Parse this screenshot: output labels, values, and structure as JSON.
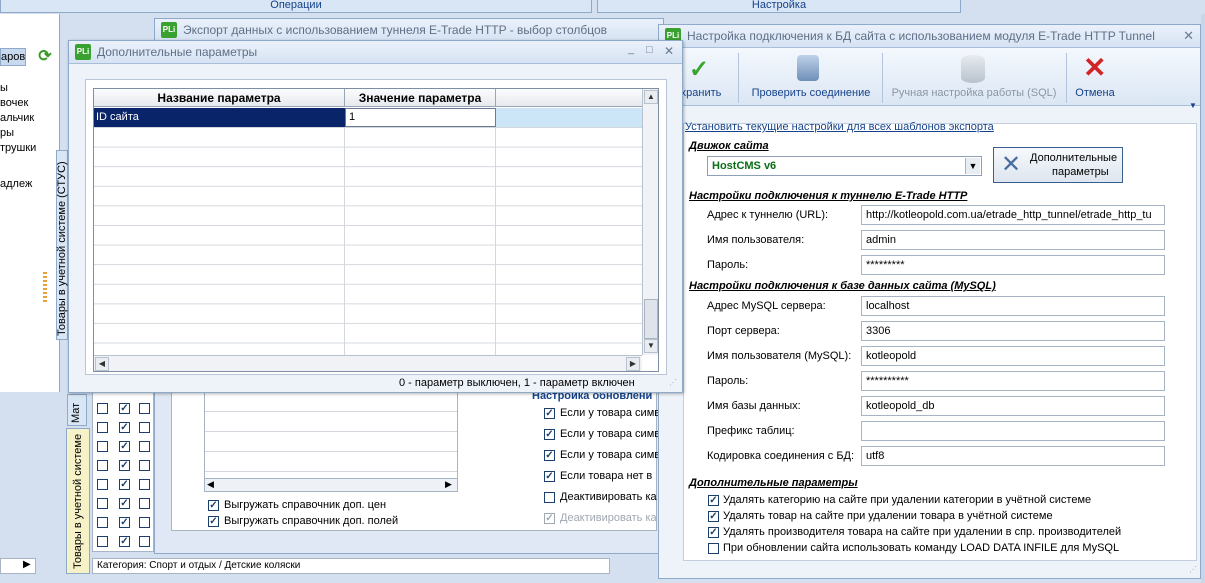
{
  "ribbon": {
    "operations_label": "Операции",
    "settings_label": "Настройка"
  },
  "left_panel": {
    "top_button_label": "аров",
    "items": [
      "ы",
      "вочек",
      "альчик",
      "ры",
      "трушки"
    ],
    "item_extra": "адлеж",
    "vertical_label_1": "Товары в учетной системе (СТУС)"
  },
  "bottom_panel": {
    "tab_materials": "Мат",
    "tab_goods": "Товары в учетной системе",
    "category_path": "Категория: Спорт и отдых / Детские коляски",
    "checkbox_rows": 8
  },
  "export_window": {
    "title": "Экспорт данных с использованием туннеля E-Trade HTTP - выбор столбцов",
    "checks_left": [
      {
        "label": "Выгружать справочник доп. цен",
        "checked": true
      },
      {
        "label": "Выгружать справочник доп. полей",
        "checked": true
      }
    ],
    "group_title": "Настройка обновлени",
    "checks_right": [
      {
        "label": "Если у товара симв",
        "checked": true
      },
      {
        "label": "Если у товара симв",
        "checked": true
      },
      {
        "label": "Если у товара симв",
        "checked": true
      },
      {
        "label": "Если товара нет в",
        "checked": true
      },
      {
        "label": "Деактивировать ка",
        "checked": false
      },
      {
        "label": "Деактивировать ка",
        "checked": true
      }
    ]
  },
  "params_window": {
    "title": "Дополнительные параметры",
    "col_name": "Название параметра",
    "col_value": "Значение параметра",
    "rows": [
      {
        "name": "ID сайта",
        "value": "1"
      }
    ],
    "status": "0 - параметр выключен, 1 - параметр включен"
  },
  "db_window": {
    "title": "Настройка подключения к БД сайта с использованием модуля E-Trade HTTP Tunnel",
    "toolbar": {
      "save": "охранить",
      "check": "Проверить соединение",
      "sql": "Ручная настройка работы (SQL)",
      "cancel": "Отмена"
    },
    "apply_all_link": "Установить текущие настройки для всех шаблонов экспорта",
    "engine_section": "Движок сайта",
    "engine_value": "HostCMS v6",
    "extra_params_button_line1": "Дополнительные",
    "extra_params_button_line2": "параметры",
    "tunnel_section": "Настройки подключения к туннелю E-Trade HTTP",
    "tunnel_fields": [
      {
        "label": "Адрес к туннелю (URL):",
        "value": "http://kotleopold.com.ua/etrade_http_tunnel/etrade_http_tu"
      },
      {
        "label": "Имя пользователя:",
        "value": "admin"
      },
      {
        "label": "Пароль:",
        "value": "*********"
      }
    ],
    "db_section": "Настройки подключения к базе данных сайта (MySQL)",
    "db_fields": [
      {
        "label": "Адрес MySQL сервера:",
        "value": "localhost"
      },
      {
        "label": "Порт сервера:",
        "value": "3306"
      },
      {
        "label": "Имя пользователя (MySQL):",
        "value": "kotleopold"
      },
      {
        "label": "Пароль:",
        "value": "**********"
      },
      {
        "label": "Имя базы данных:",
        "value": "kotleopold_db"
      },
      {
        "label": "Префикс таблиц:",
        "value": ""
      },
      {
        "label": "Кодировка соединения с БД:",
        "value": "utf8"
      }
    ],
    "extra_section": "Дополнительные параметры",
    "extra_checks": [
      {
        "label": "Удалять категорию на сайте при удалении категории в учётной системе",
        "checked": true
      },
      {
        "label": "Удалять товар на сайте при удалении товара в учётной системе",
        "checked": true
      },
      {
        "label": "Удалять производителя товара на сайте при удалении в спр. производителей",
        "checked": true
      },
      {
        "label": "При обновлении сайта использовать команду LOAD DATA INFILE для MySQL",
        "checked": false
      }
    ]
  }
}
